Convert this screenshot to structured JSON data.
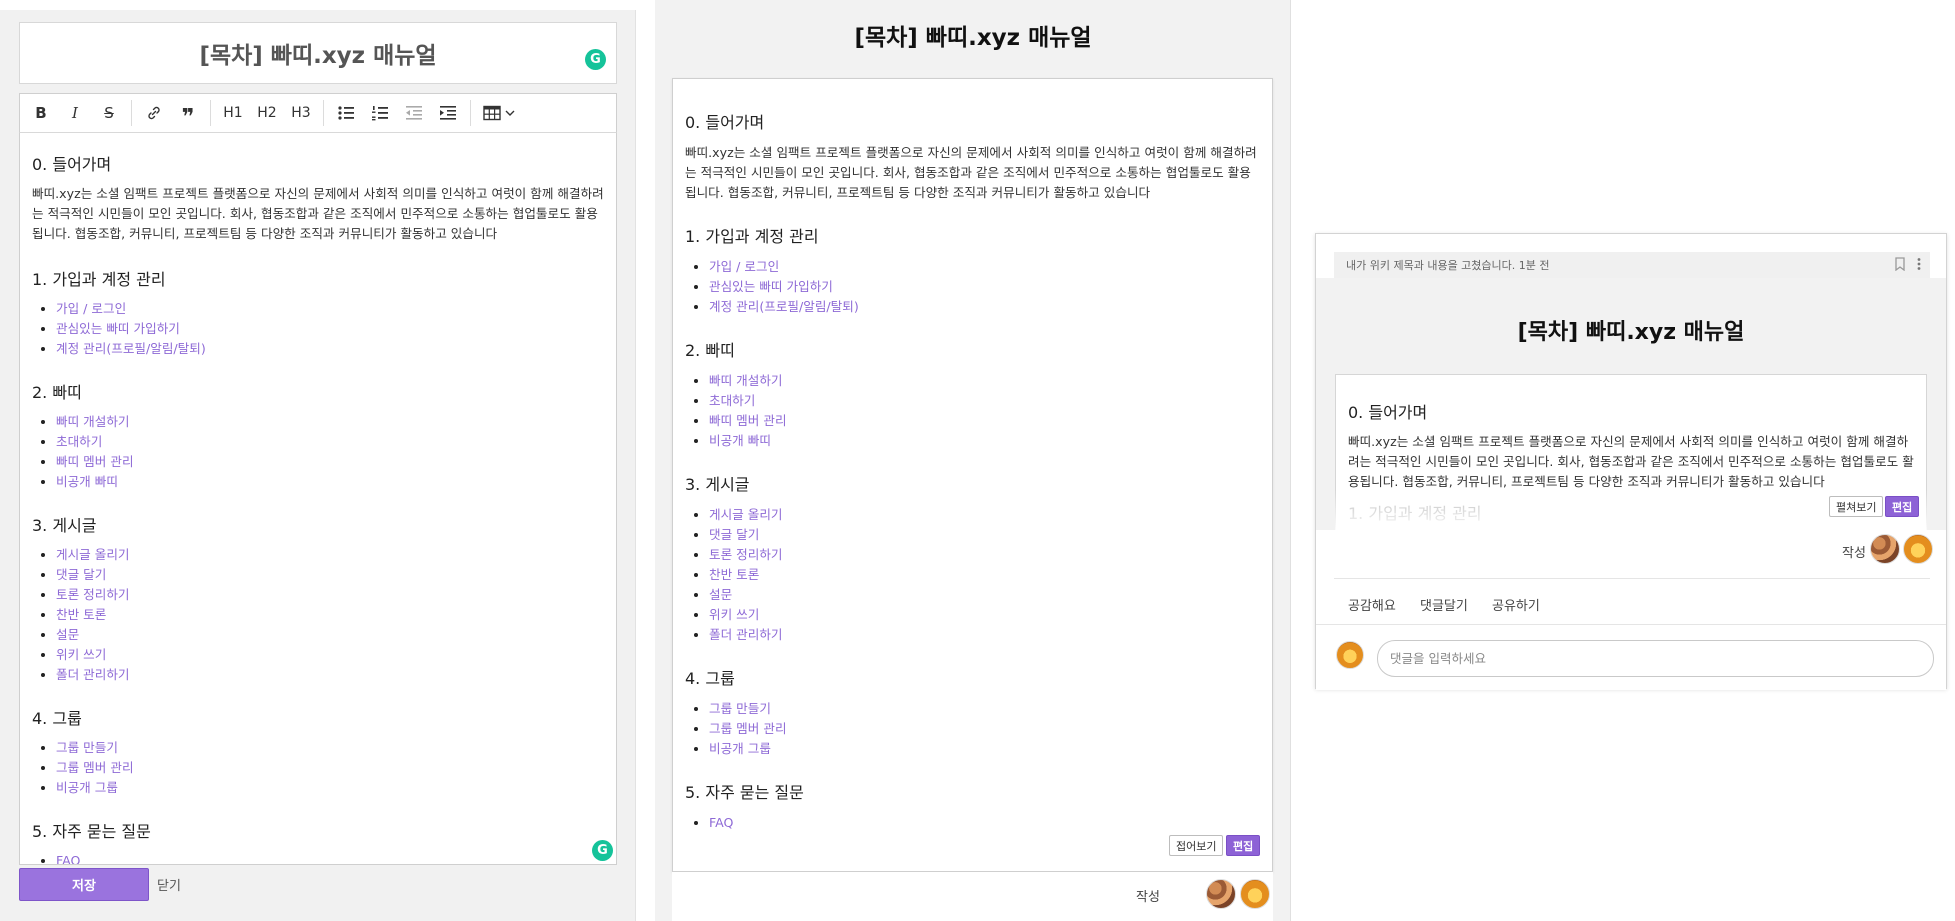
{
  "editor": {
    "title": "[목차] 빠띠.xyz 매뉴얼",
    "toolbar": {
      "bold": "B",
      "italic": "I",
      "strike": "S",
      "link": "🔗",
      "quote": "❞",
      "h1": "H1",
      "h2": "H2",
      "h3": "H3",
      "bullet_list": "☰",
      "ordered_list": "⒈",
      "outdent": "⇤",
      "indent": "⇥",
      "table": "▦"
    },
    "save_label": "저장",
    "close_label": "닫기",
    "grammarly_icon": "G"
  },
  "doc": {
    "intro": {
      "heading": "0. 들어가며",
      "body": "빠띠.xyz는 소셜 임팩트 프로젝트 플랫폼으로 자신의 문제에서 사회적 의미를 인식하고 여럿이 함께 해결하려는 적극적인 시민들이 모인 곳입니다. 회사, 협동조합과 같은 조직에서 민주적으로 소통하는 협업툴로도 활용됩니다. 협동조합, 커뮤니티, 프로젝트팀 등 다양한 조직과 커뮤니티가 활동하고 있습니다"
    },
    "sections": [
      {
        "heading": "1. 가입과 계정 관리",
        "items": [
          "가입 / 로그인",
          "관심있는 빠띠 가입하기",
          "계정 관리(프로필/알림/탈퇴)"
        ]
      },
      {
        "heading": "2. 빠띠",
        "items": [
          "빠띠 개설하기",
          "초대하기",
          "빠띠 멤버 관리",
          "비공개 빠띠"
        ]
      },
      {
        "heading": "3. 게시글",
        "items": [
          "게시글 올리기",
          "댓글 달기",
          "토론 정리하기",
          "찬반 토론",
          "설문",
          "위키 쓰기",
          "폴더 관리하기"
        ]
      },
      {
        "heading": "4. 그룹",
        "items": [
          "그룹 만들기",
          "그룹 멤버 관리",
          "비공개 그룹"
        ]
      },
      {
        "heading": "5. 자주 묻는 질문",
        "items": [
          "FAQ"
        ]
      }
    ]
  },
  "preview": {
    "title": "[목차] 빠띠.xyz 매뉴얼",
    "collapse_label": "접어보기",
    "edit_label": "편집",
    "author_label": "작성"
  },
  "wiki": {
    "notice": "내가 위키 제목과 내용을 고쳤습니다. 1분 전",
    "title": "[목차] 빠띠.xyz 매뉴얼",
    "expand_label": "펼쳐보기",
    "edit_label": "편집",
    "author_label": "작성",
    "actions": [
      "공감해요",
      "댓글달기",
      "공유하기"
    ],
    "comment_placeholder": "댓글을 입력하세요",
    "icons": [
      "bookmark-icon",
      "more-vertical-icon"
    ]
  },
  "colors": {
    "accent": "#9a73de",
    "link": "#8e6ad6",
    "grammarly": "#15c39a"
  }
}
